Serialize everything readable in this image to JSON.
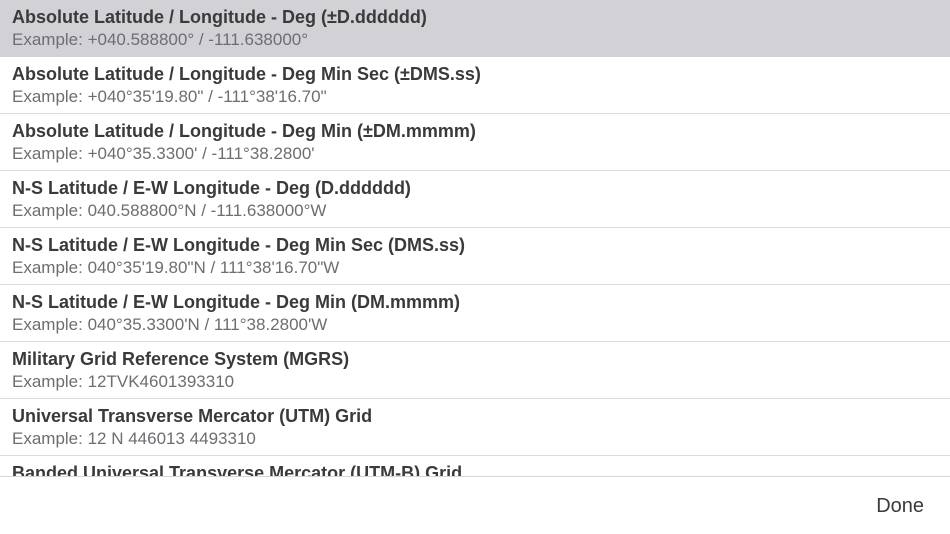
{
  "formats": [
    {
      "title": "Absolute Latitude / Longitude - Deg (±D.dddddd)",
      "example": "Example: +040.588800° / -111.638000°",
      "selected": true
    },
    {
      "title": "Absolute Latitude / Longitude - Deg Min Sec (±DMS.ss)",
      "example": "Example: +040°35'19.80\" / -111°38'16.70\"",
      "selected": false
    },
    {
      "title": "Absolute Latitude / Longitude - Deg Min (±DM.mmmm)",
      "example": "Example: +040°35.3300' / -111°38.2800'",
      "selected": false
    },
    {
      "title": "N-S Latitude / E-W Longitude - Deg (D.dddddd)",
      "example": "Example: 040.588800°N / -111.638000°W",
      "selected": false
    },
    {
      "title": "N-S Latitude / E-W Longitude - Deg Min Sec (DMS.ss)",
      "example": "Example: 040°35'19.80\"N / 111°38'16.70\"W",
      "selected": false
    },
    {
      "title": "N-S Latitude / E-W Longitude - Deg Min (DM.mmmm)",
      "example": "Example: 040°35.3300'N / 111°38.2800'W",
      "selected": false
    },
    {
      "title": "Military Grid Reference System (MGRS)",
      "example": "Example: 12TVK4601393310",
      "selected": false
    },
    {
      "title": "Universal Transverse Mercator (UTM) Grid",
      "example": "Example: 12 N 446013 4493310",
      "selected": false
    },
    {
      "title": "Banded Universal Transverse Mercator (UTM-B) Grid",
      "example": "",
      "selected": false
    }
  ],
  "footer": {
    "done_label": "Done"
  },
  "colors": {
    "selected_row": "#d1d1d6",
    "title_text": "#3a3a3c",
    "subtitle_text": "#6d6d72",
    "separator": "#dcdcdc"
  }
}
